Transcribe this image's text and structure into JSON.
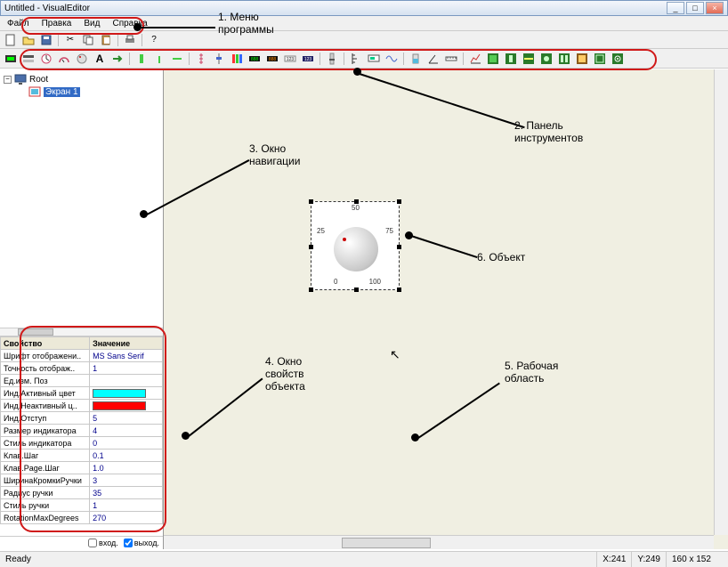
{
  "window": {
    "title": "Untitled - VisualEditor"
  },
  "menu": {
    "file": "Файл",
    "edit": "Правка",
    "view": "Вид",
    "help": "Справка"
  },
  "tree": {
    "root": "Root",
    "screen1": "Экран 1"
  },
  "props": {
    "header_prop": "Свойство",
    "header_val": "Значение",
    "rows": [
      {
        "name": "Шрифт отображени..",
        "value": "MS Sans Serif"
      },
      {
        "name": "Точность отображ..",
        "value": "1"
      },
      {
        "name": "Ед.изм. Поз",
        "value": ""
      },
      {
        "name": "Инд.Активный цвет",
        "value": "#00FFFF",
        "color": true
      },
      {
        "name": "Инд.Неактивный ц..",
        "value": "#FF0000",
        "color": true
      },
      {
        "name": "Инд.Отступ",
        "value": "5"
      },
      {
        "name": "Размер индикатора",
        "value": "4"
      },
      {
        "name": "Стиль индикатора",
        "value": "0"
      },
      {
        "name": "Клав.Шаг",
        "value": "0.1"
      },
      {
        "name": "Клав.Page.Шаг",
        "value": "1.0"
      },
      {
        "name": "ШиринаКромкиРучки",
        "value": "3"
      },
      {
        "name": "Радиус ручки",
        "value": "35"
      },
      {
        "name": "Стиль ручки",
        "value": "1"
      },
      {
        "name": "RotationMaxDegrees",
        "value": "270"
      }
    ]
  },
  "knob": {
    "l0": "0",
    "l25": "25",
    "l50": "50",
    "l75": "75",
    "l100": "100"
  },
  "checks": {
    "in": "вход.",
    "out": "выход.",
    "in_checked": false,
    "out_checked": true
  },
  "status": {
    "ready": "Ready",
    "x": "X:241",
    "y": "Y:249",
    "size": "160 x 152"
  },
  "annot": {
    "a1": "1. Меню\nпрограммы",
    "a2": "2. Панель\nинструментов",
    "a3": "3. Окно\nнавигации",
    "a4": "4. Окно\nсвойств\nобъекта",
    "a5": "5. Рабочая\nобласть",
    "a6": "6. Объект"
  }
}
